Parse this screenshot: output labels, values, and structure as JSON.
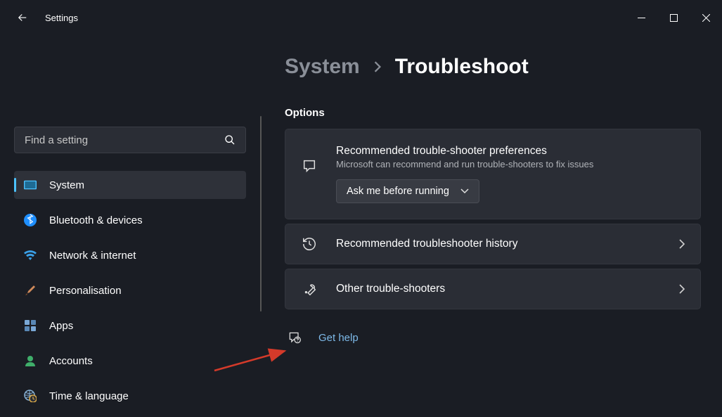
{
  "window": {
    "title": "Settings"
  },
  "search": {
    "placeholder": "Find a setting"
  },
  "sidebar": {
    "items": [
      {
        "label": "System"
      },
      {
        "label": "Bluetooth & devices"
      },
      {
        "label": "Network & internet"
      },
      {
        "label": "Personalisation"
      },
      {
        "label": "Apps"
      },
      {
        "label": "Accounts"
      },
      {
        "label": "Time & language"
      }
    ]
  },
  "breadcrumb": {
    "parent": "System",
    "current": "Troubleshoot"
  },
  "section_options": "Options",
  "cards": {
    "prefs": {
      "title": "Recommended trouble-shooter preferences",
      "sub": "Microsoft can recommend and run trouble-shooters to fix issues",
      "dropdown": "Ask me before running"
    },
    "history": {
      "title": "Recommended troubleshooter history"
    },
    "other": {
      "title": "Other trouble-shooters"
    }
  },
  "help": {
    "label": "Get help"
  }
}
